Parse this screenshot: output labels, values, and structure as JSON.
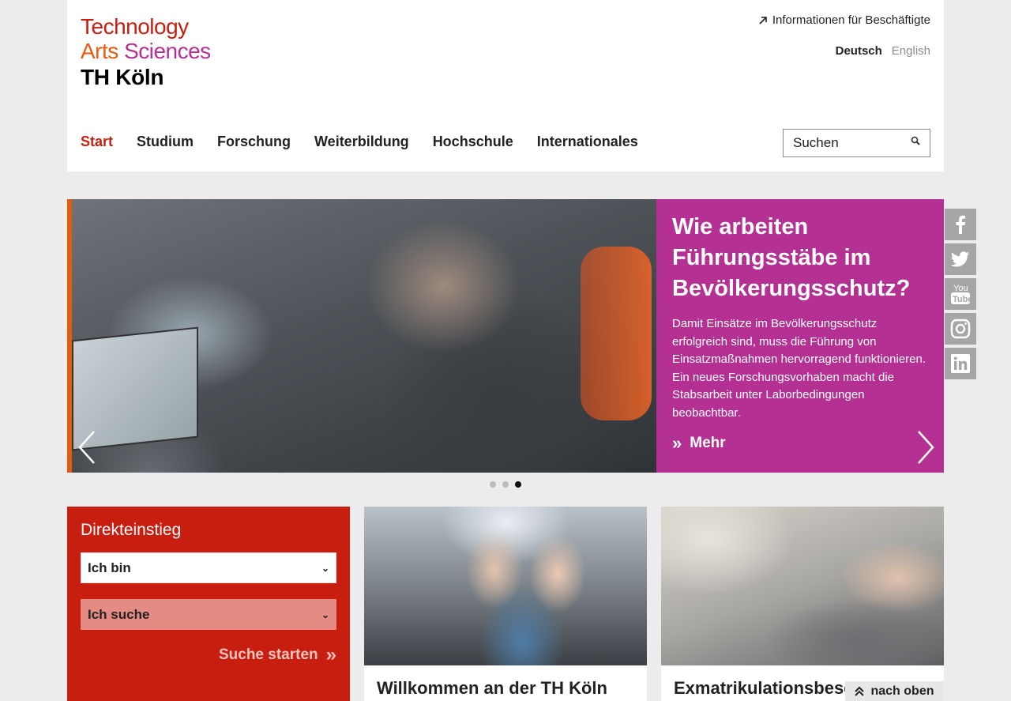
{
  "logo": {
    "line1": "Technology",
    "line2a": "Arts",
    "line2b": "Sciences",
    "line3": "TH Köln"
  },
  "util": {
    "link": "Informationen für Beschäftigte"
  },
  "lang": {
    "active": "Deutsch",
    "other": "English"
  },
  "nav": {
    "items": [
      "Start",
      "Studium",
      "Forschung",
      "Weiterbildung",
      "Hochschule",
      "Internationales"
    ]
  },
  "search": {
    "placeholder": "Suchen"
  },
  "slide": {
    "title": "Wie arbeiten Führungsstäbe im Bevölkerungsschutz?",
    "text": "Damit Einsätze im Bevölkerungsschutz erfolgreich sind, muss die Führung von Einsatzmaßnahmen hervorragend funktionieren. Ein neues Forschungsvorhaben macht die Stabsarbeit unter Laborbedingungen beobachtbar.",
    "more": "Mehr",
    "active_dot": 3,
    "dot_count": 3
  },
  "social": [
    "facebook-icon",
    "twitter-icon",
    "youtube-icon",
    "instagram-icon",
    "linkedin-icon"
  ],
  "direkt": {
    "title": "Direkteinstieg",
    "select1": "Ich bin",
    "select2": "Ich suche",
    "submit": "Suche starten"
  },
  "cards": [
    {
      "title": "Willkommen an der TH Köln"
    },
    {
      "title": "Exmatrikulationsbesche"
    }
  ],
  "back_to_top": "nach oben",
  "colors": {
    "red": "#c81e0f",
    "orange": "#ea5a0c",
    "magenta": "#b43092"
  }
}
